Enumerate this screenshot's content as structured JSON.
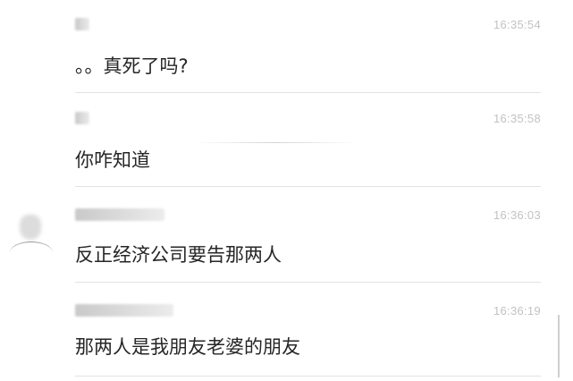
{
  "messages": [
    {
      "time": "16:35:54",
      "text": "。。真死了吗?"
    },
    {
      "time": "16:35:58",
      "text": "你咋知道"
    },
    {
      "time": "16:36:03",
      "text": "反正经济公司要告那两人"
    },
    {
      "time": "16:36:19",
      "text": "那两人是我朋友老婆的朋友"
    }
  ],
  "colors": {
    "background": "#ffffff",
    "message_text": "#262626",
    "timestamp": "#c2c2c2",
    "separator": "#e2e2e2"
  }
}
